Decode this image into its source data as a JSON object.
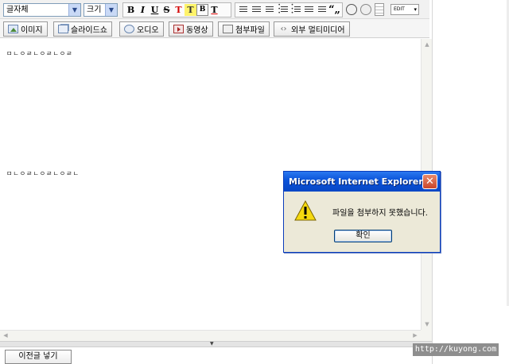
{
  "toolbar": {
    "font_select": "글자체",
    "size_select": "크기",
    "format": {
      "bold": "B",
      "italic": "I",
      "underline": "U",
      "strike": "S",
      "text_color": "T",
      "highlight": "T",
      "box": "B",
      "clear": "T"
    },
    "quote": "“„",
    "edit_label": "EDIT"
  },
  "media": {
    "image": "이미지",
    "slideshow": "슬라이드쇼",
    "audio": "오디오",
    "video": "동영상",
    "attach": "첨부파일",
    "external": "외부 멀티미디어"
  },
  "editor": {
    "line1": "ㅁㄴㅇㄹㄴㅇㄹㄴㅇㄹ",
    "line2": "ㅁㄴㅇㄹㄴㅇㄹㄴㅇㄹㄴ"
  },
  "dialog": {
    "title": "Microsoft Internet Explorer",
    "close": "✕",
    "message": "파일을 첨부하지 못했습니다.",
    "ok": "확인"
  },
  "footer": {
    "prev_button": "이전글 넣기",
    "watermark": "http://kuyong.com"
  }
}
